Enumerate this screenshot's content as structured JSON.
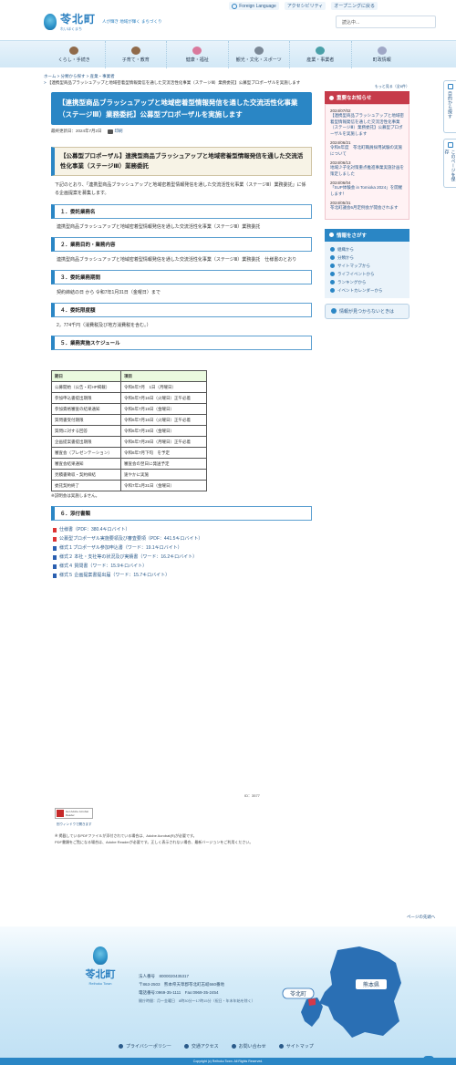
{
  "util": {
    "foreign_language": "Foreign Language",
    "accessibility": "アクセシビリティ",
    "opening": "オープニングに戻る"
  },
  "header": {
    "logo_name": "苓北町",
    "logo_kana": "れいほくまち",
    "tagline": "人が輝き 地域が輝く まちづくり",
    "search_placeholder": "読込中..."
  },
  "gnav": [
    {
      "label": "くらし・手続き",
      "icon": "house-icon"
    },
    {
      "label": "子育て・教育",
      "icon": "schoolbag-icon"
    },
    {
      "label": "健康・福祉",
      "icon": "flower-icon"
    },
    {
      "label": "観光・文化・スポーツ",
      "icon": "camera-icon"
    },
    {
      "label": "産業・事業者",
      "icon": "factory-icon"
    },
    {
      "label": "町政情報",
      "icon": "document-icon"
    }
  ],
  "breadcrumb": {
    "home": "ホーム",
    "c1": "分類から探す",
    "c2": "産業・事業者",
    "current": "【連携型商品ブラッシュアップと地域密着型情報発信を通した交流活性化事業（ステージⅢ）業務委託】公募型プロポーザルを実施します"
  },
  "side_tabs": {
    "search_by_purpose": "目的から探す",
    "save_page": "このページを保存"
  },
  "article": {
    "title": "【連携型商品ブラッシュアップと地域密着型情報発信を通した交流活性化事業（ステージⅢ）業務委託】公募型プロポーザルを実施します",
    "updated": "最終更新日：2024年7月2日",
    "print": "印刷",
    "sub_title": "【公募型プロポーザル】連携型商品ブラッシュアップと地域密着型情報発信を通した交流活性化事業（ステージⅢ）業務委託",
    "intro": "下記のとおり、「連携型商品ブラッシュアップと地域密着型情報発信を通した交流活性化事業（ステージⅢ）業務委託」に係る企画提案を募集します。",
    "sections": [
      {
        "heading": "１．委託業務名",
        "body": "連携型商品ブラッシュアップと地域密着型情報発信を通した交流活性化事業（ステージⅢ）業務委託"
      },
      {
        "heading": "２．業務目的・業務内容",
        "body": "連携型商品ブラッシュアップと地域密着型情報発信を通した交流活性化事業（ステージⅢ）業務委託　仕様書のとおり"
      },
      {
        "heading": "３．委託業務期間",
        "body": "契約締結の日 から 令和7年1月31日（金曜日）まで"
      },
      {
        "heading": "４．委託限度額",
        "body": "2，774千円（消費税及び地方消費税を含む。）"
      },
      {
        "heading": "５．業務実施スケジュール",
        "body": ""
      }
    ],
    "schedule_headers": [
      "期日",
      "項目"
    ],
    "schedule": [
      [
        "公募開始（公告・町HP掲載）",
        "令和6年7月　1日（月曜日）"
      ],
      [
        "参加申込書提出期限",
        "令和6年7月16日（火曜日）正午必着"
      ],
      [
        "参加資格審査の結果通知",
        "令和6年7月19日（金曜日）"
      ],
      [
        "質問書受付期限",
        "令和6年7月16日（火曜日）正午必着"
      ],
      [
        "質問に対する回答",
        "令和6年7月19日（金曜日）"
      ],
      [
        "企画提案書提出期限",
        "令和6年7月29日（月曜日）正午必着"
      ],
      [
        "審査会（プレゼンテーション）",
        "令和6年7月下旬　を予定"
      ],
      [
        "審査会結果通知",
        "審査会の翌日に発送予定"
      ],
      [
        "見積書徴収・契約締結",
        "速やかに実施"
      ],
      [
        "委託契約終了",
        "令和7年1月31日（金曜日）"
      ]
    ],
    "schedule_note": "※説明会は実施しません。",
    "attach_heading": "６．添付書類",
    "attachments": [
      {
        "label": "仕様書（PDF：380.4キロバイト）",
        "type": "pdf"
      },
      {
        "label": "公募型プロポーザル実施要領及び審査要項（PDF：441.5キロバイト）",
        "type": "pdf"
      },
      {
        "label": "様式１プロポーザル参加申込書（ワード：19.1キロバイト）",
        "type": "word"
      },
      {
        "label": "様式２ 本社・支社等の状況及び実績書（ワード：16.2キロバイト）",
        "type": "word"
      },
      {
        "label": "様式４ 質問書（ワード：15.9キロバイト）",
        "type": "word"
      },
      {
        "label": "様式５ 企画提案書提出届（ワード：15.7キロバイト）",
        "type": "word"
      }
    ],
    "page_id": "ID：3577",
    "acrobat_caption": "Get Adobe Acrobat Reader",
    "acrobat_link": "別ウィンドウで開きます",
    "acrobat_note1": "※ 掲載しているPDFファイルが添付されている場合は、Adobe Acrobat(R)が必要です。",
    "acrobat_note2": "PDF書類をご覧になる場合は、Adobe Readerが必要です。正しく表示されない場合、最新バージョンをご利用ください。"
  },
  "aside": {
    "more": "もっと見る（全6件）",
    "notice_title": "重要なお知らせ",
    "notices": [
      {
        "date": "2024/07/02",
        "text": "【連携型商品ブラッシュアップと地域密着型情報発信を通した交流活性化事業（ステージⅢ）業務委託】公募型プロポーザルを実施します"
      },
      {
        "date": "2024/06/21",
        "text": "令和6年度　苓北町職員採用試験の実施について"
      },
      {
        "date": "2024/06/13",
        "text": "地域少子化対策重点推進事業実施計画を策定しました"
      },
      {
        "date": "2024/06/04",
        "text": "「SUP体験会 in Tomioka 2024」を開催します！"
      },
      {
        "date": "2024/05/31",
        "text": "苓北町議会6月定例会が開会されます"
      }
    ],
    "find_title": "情報をさがす",
    "find_items": [
      "組織から",
      "分類から",
      "サイトマップから",
      "ライフイベントから",
      "ランキングから",
      "イベントカレンダーから"
    ],
    "help": "情報が見つからないときは"
  },
  "to_top": "ページの先頭へ",
  "footer": {
    "logo_name": "苓北町",
    "logo_roman": "Reihoku Town",
    "corp_no": "法人番号　8000020435317",
    "address": "〒863-2503　熊本県天草郡苓北町志岐660番地",
    "phone": "電話番号:0969-35-1111　Fax:0969-35-2454",
    "hours": "開庁時間：月～金曜日　8時30分～17時15分（祝日・年末年始を除く）",
    "map_label_town": "苓北町",
    "map_label_pref": "熊本県",
    "nav": [
      "プライバシーポリシー",
      "交通アクセス",
      "お問い合わせ",
      "サイトマップ"
    ],
    "copyright": "Copyright (c) Reihoku Town. All Rights Reserved."
  },
  "colors": {
    "brand": "#2a86c5",
    "notice": "#c63b4a",
    "table_head": "#eafadf"
  }
}
